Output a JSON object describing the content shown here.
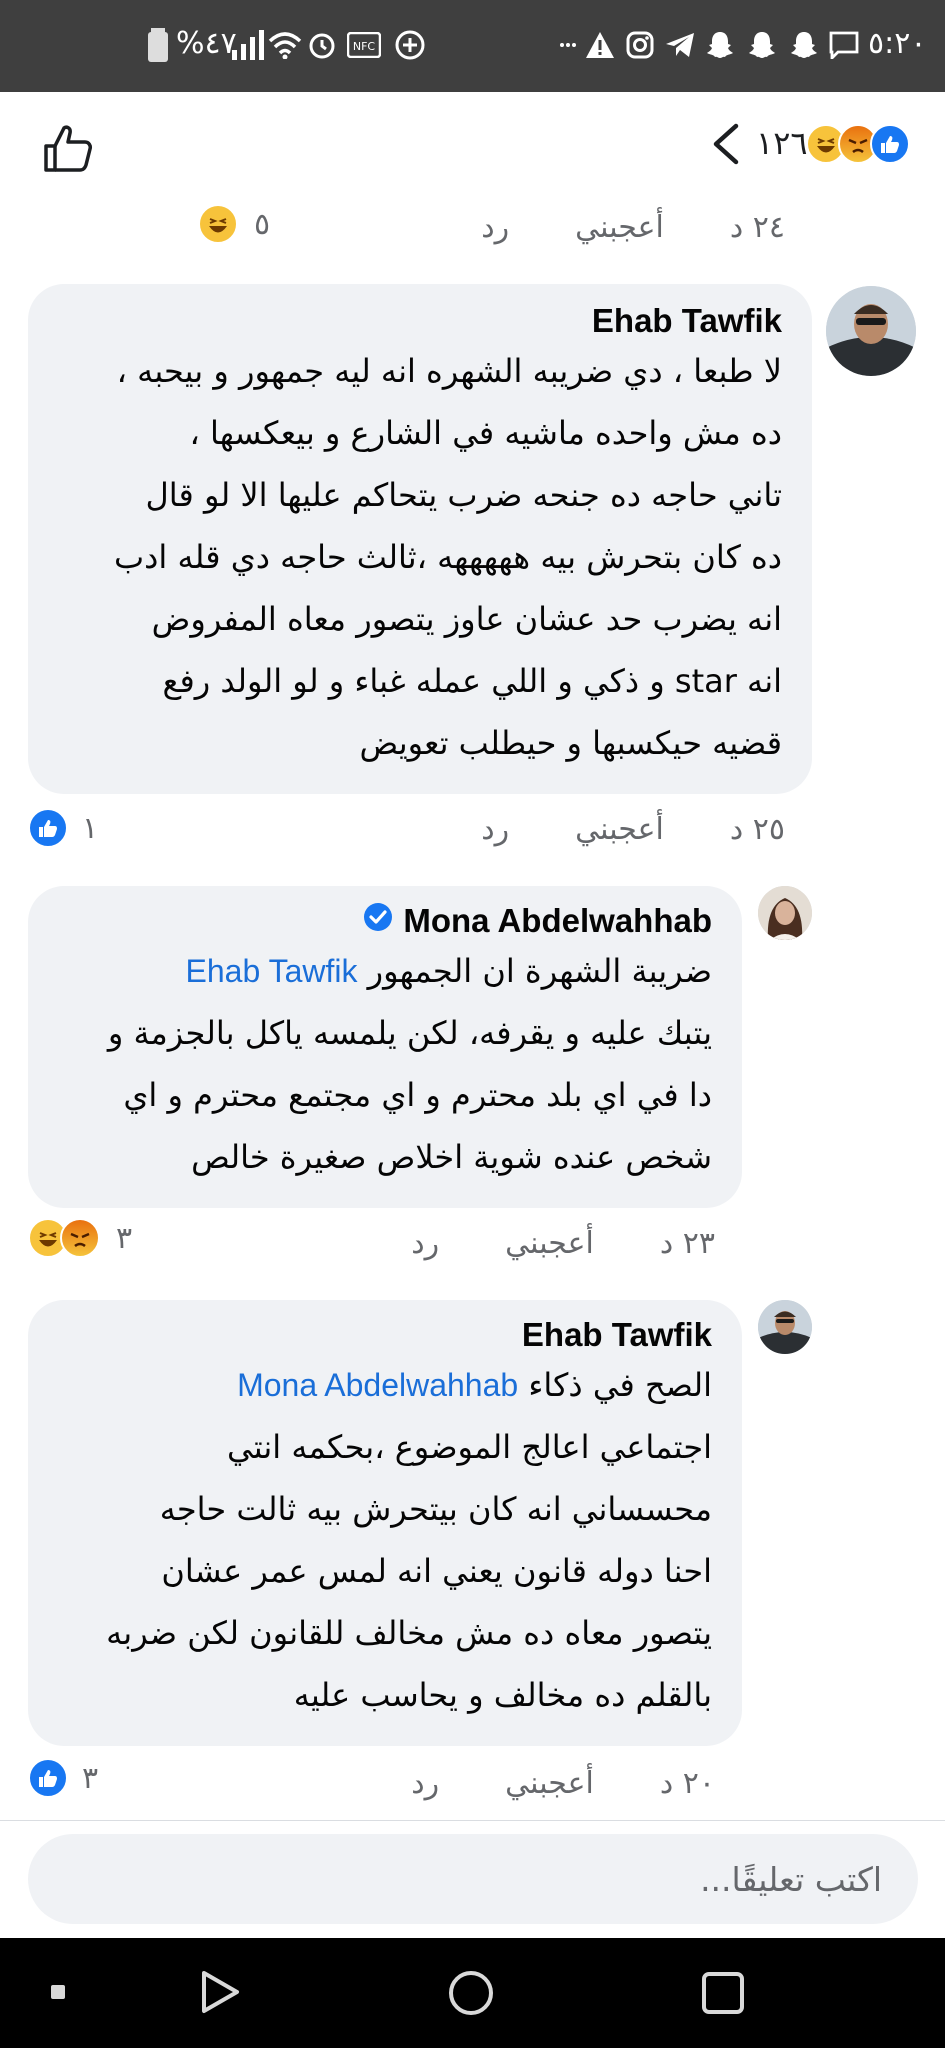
{
  "status_bar": {
    "time": "٥:٢٠",
    "battery": "%٤٧",
    "nfc": "NFC"
  },
  "header": {
    "reaction_count": "١٢٦",
    "reactions": [
      "like-icon",
      "angry-icon",
      "haha-icon"
    ],
    "like_icon": "thumbs-up-outline-icon"
  },
  "first_meta": {
    "time": "٢٤ د",
    "like": "أعجبني",
    "reply": "رد",
    "reaction_count": "٥"
  },
  "comments": [
    {
      "author": "Ehab Tawfik",
      "lines": [
        "لا طبعا ، دي ضريبه الشهره انه ليه جمهور و بيحبه ،",
        "ده  مش واحده ماشيه في الشارع و بيعكسها ،",
        "تاني حاجه ده جنحه ضرب يتحاكم عليها الا لو قال",
        "ده كان بتحرش بيه هههههه ،ثالث حاجه   دي قله ادب",
        "انه يضرب حد عشان عاوز يتصور معاه   المفروض",
        "انه star و ذكي  و اللي عمله غباء و لو الولد رفع",
        "قضيه حيكسبها و حيطلب تعويض"
      ],
      "time": "٢٥ د",
      "like": "أعجبني",
      "reply": "رد",
      "reaction_count": "١"
    },
    {
      "author": "Mona Abdelwahhab",
      "verified": true,
      "mention": "Ehab Tawfik",
      "first_line_text": "ضريبة الشهرة ان الجمهور",
      "lines": [
        "يتبك عليه و يقرفه، لكن يلمسه ياكل بالجزمة و",
        "دا في اي بلد محترم و اي مجتمع محترم و اي",
        "شخص عنده شوية اخلاص صغيرة خالص"
      ],
      "time": "٢٣ د",
      "like": "أعجبني",
      "reply": "رد",
      "reaction_count": "٣"
    },
    {
      "author": "Ehab Tawfik",
      "mention": "Mona Abdelwahhab",
      "first_line_text": "الصح في ذكاء",
      "lines": [
        "اجتماعي اعالج الموضوع   ،بحكمه انتي",
        "محسساني انه كان بيتحرش بيه ثالت حاجه",
        "احنا دوله قانون يعني انه لمس عمر عشان",
        "يتصور معاه ده مش مخالف للقانون لكن ضربه",
        "بالقلم ده مخالف و يحاسب عليه"
      ],
      "time": "٢٠ د",
      "like": "أعجبني",
      "reply": "رد",
      "reaction_count": "٣"
    }
  ],
  "composer": {
    "placeholder": "اكتب تعليقًا..."
  },
  "colors": {
    "bubble": "#f0f2f5",
    "mention": "#1a6ed8",
    "meta": "#65676b",
    "like": "#1877f2"
  }
}
